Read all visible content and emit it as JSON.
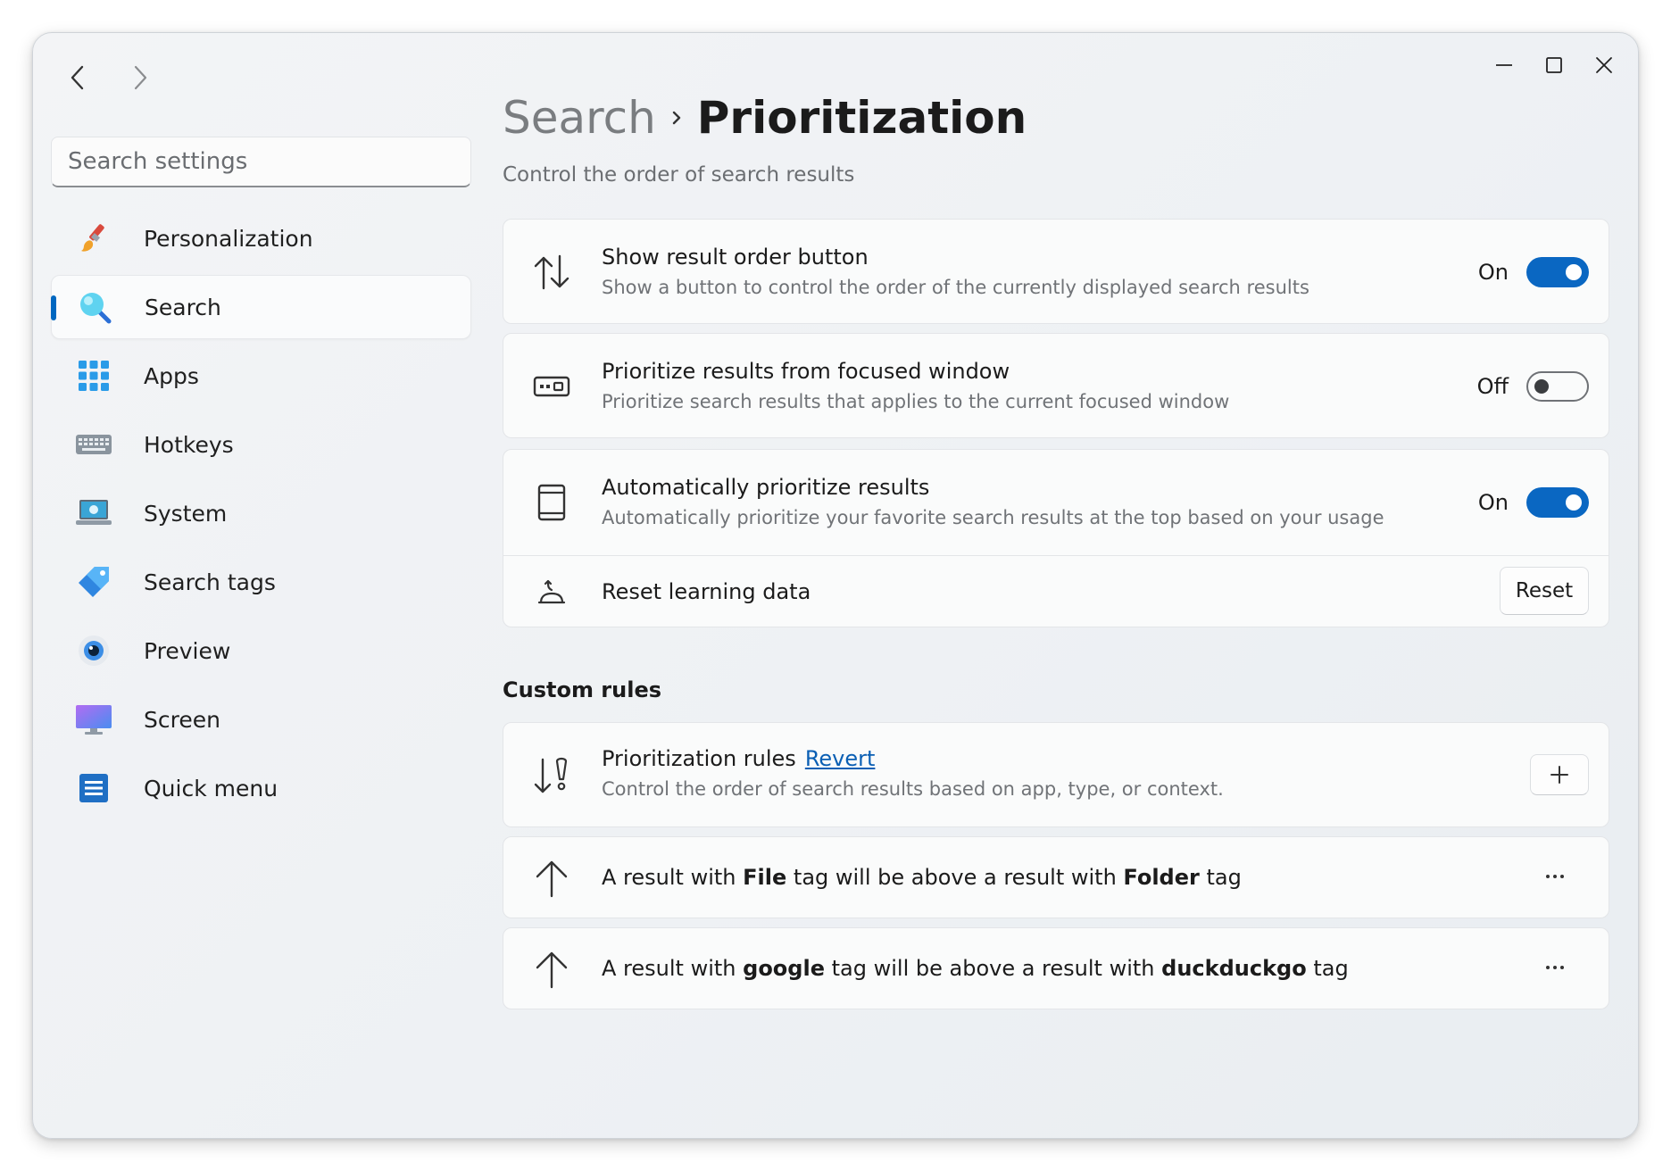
{
  "window": {
    "controls": {
      "minimize": "minimize-icon",
      "maximize": "maximize-icon",
      "close": "close-icon"
    }
  },
  "sidebar": {
    "search_placeholder": "Search settings",
    "items": [
      {
        "label": "Personalization",
        "icon": "paintbrush-icon"
      },
      {
        "label": "Search",
        "icon": "magnifier-icon",
        "selected": true
      },
      {
        "label": "Apps",
        "icon": "apps-grid-icon"
      },
      {
        "label": "Hotkeys",
        "icon": "keyboard-icon"
      },
      {
        "label": "System",
        "icon": "laptop-icon"
      },
      {
        "label": "Search tags",
        "icon": "tag-icon"
      },
      {
        "label": "Preview",
        "icon": "eye-icon"
      },
      {
        "label": "Screen",
        "icon": "monitor-icon"
      },
      {
        "label": "Quick menu",
        "icon": "list-menu-icon"
      }
    ]
  },
  "header": {
    "breadcrumb_parent": "Search",
    "title": "Prioritization",
    "subtitle": "Control the order of search results"
  },
  "settings": {
    "show_order_button": {
      "title": "Show result order button",
      "desc": "Show a button to control the order of the currently displayed search results",
      "state": "On",
      "on": true
    },
    "focused_window": {
      "title": "Prioritize results from focused window",
      "desc": "Prioritize search results that applies to the current focused window",
      "state": "Off",
      "on": false
    },
    "auto_prioritize": {
      "title": "Automatically prioritize results",
      "desc": "Automatically prioritize your favorite search results at the top based on your usage",
      "state": "On",
      "on": true
    },
    "reset_learning": {
      "title": "Reset learning data",
      "button": "Reset"
    }
  },
  "custom_rules": {
    "section_title": "Custom rules",
    "rules_title": "Prioritization rules",
    "revert_label": "Revert",
    "rules_desc": "Control the order of search results based on app, type, or context.",
    "add_button": "+",
    "rules": [
      {
        "prefix": "A result with",
        "a": "File",
        "middle": "tag will be above a result with",
        "b": "Folder",
        "suffix": "tag"
      },
      {
        "prefix": "A result with",
        "a": "google",
        "middle": "tag will be above a result with",
        "b": "duckduckgo",
        "suffix": "tag"
      }
    ],
    "more_label": "···"
  },
  "colors": {
    "accent": "#0a67c2",
    "link": "#0a5fb4"
  }
}
